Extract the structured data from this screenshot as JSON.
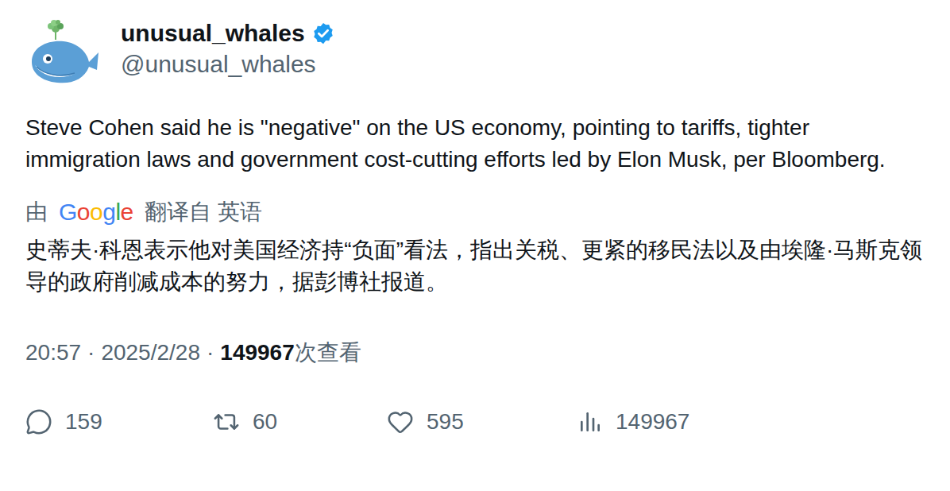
{
  "author": {
    "name": "unusual_whales",
    "handle": "@unusual_whales",
    "verified": true
  },
  "tweet": {
    "text": "Steve Cohen said he is \"negative\" on the US economy, pointing to tariffs, tighter immigration laws and government cost-cutting efforts led by Elon Musk, per Bloomberg."
  },
  "translation": {
    "prefix": "由",
    "logo": {
      "text": "Google",
      "colors": [
        "#4285F4",
        "#EA4335",
        "#FBBC05",
        "#4285F4",
        "#34A853",
        "#EA4335"
      ]
    },
    "suffix": "翻译自 英语",
    "text": "史蒂夫·科恩表示他对美国经济持“负面”看法，指出关税、更紧的移民法以及由埃隆·马斯克领导的政府削减成本的努力，据彭博社报道。"
  },
  "meta": {
    "time": "20:57",
    "date": "2025/2/28",
    "separator": "·",
    "views": "149967",
    "views_label": "次查看"
  },
  "actions": [
    {
      "kind": "reply",
      "count": "159"
    },
    {
      "kind": "retweet",
      "count": "60"
    },
    {
      "kind": "like",
      "count": "595"
    },
    {
      "kind": "views",
      "count": "149967"
    }
  ]
}
